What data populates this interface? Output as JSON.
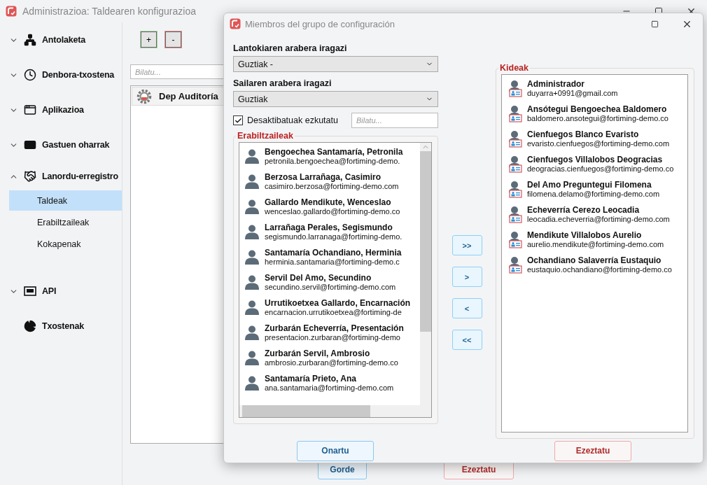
{
  "main_window": {
    "title": "Administrazioa: Taldearen konfigurazioa",
    "sidebar": [
      {
        "label": "Antolaketa",
        "kind": "section",
        "expanded": false
      },
      {
        "label": "Denbora-txostena",
        "kind": "section",
        "expanded": false
      },
      {
        "label": "Aplikazioa",
        "kind": "section",
        "expanded": false
      },
      {
        "label": "Gastuen oharrak",
        "kind": "section",
        "expanded": false
      },
      {
        "label": "Lanordu-erregistro",
        "kind": "section",
        "expanded": true,
        "children": [
          {
            "label": "Taldeak",
            "selected": true
          },
          {
            "label": "Erabiltzaileak",
            "selected": false
          },
          {
            "label": "Kokapenak",
            "selected": false
          }
        ]
      },
      {
        "label": "API",
        "kind": "section",
        "expanded": false
      },
      {
        "label": "Txostenak",
        "kind": "link"
      }
    ],
    "toolbar": [
      {
        "label": "+",
        "kind": "add"
      },
      {
        "label": "-",
        "kind": "remove"
      }
    ],
    "search": {
      "placeholder": "Bilatu..."
    },
    "groups": [
      {
        "name": "Dep Auditoría"
      }
    ],
    "buttons": [
      {
        "label": "Gorde",
        "kind": "confirm"
      },
      {
        "label": "Ezeztatu",
        "kind": "cancel"
      }
    ]
  },
  "dialog": {
    "title": "Miembros del grupo de configuración",
    "filters": [
      {
        "label": "Lantokiaren arabera iragazi",
        "value": "Guztiak -"
      },
      {
        "label": "Sailaren arabera iragazi",
        "value": "Guztiak"
      }
    ],
    "hide_inactive": {
      "label": "Desaktibatuak ezkutatu",
      "checked": true
    },
    "search": {
      "placeholder": "Bilatu..."
    },
    "users": {
      "title": "Erabiltzaileak",
      "items": [
        {
          "name": "Bengoechea Santamaría, Petronila",
          "email": "petronila.bengoechea@fortiming-demo."
        },
        {
          "name": "Berzosa Larrañaga, Casimiro",
          "email": "casimiro.berzosa@fortiming-demo.com"
        },
        {
          "name": "Gallardo Mendikute, Wenceslao",
          "email": "wenceslao.gallardo@fortiming-demo.co"
        },
        {
          "name": "Larrañaga Perales, Segismundo",
          "email": "segismundo.larranaga@fortiming-demo."
        },
        {
          "name": "Santamaría Ochandiano, Herminia",
          "email": "herminia.santamaria@fortiming-demo.c"
        },
        {
          "name": "Servil Del Amo, Secundino",
          "email": "secundino.servil@fortiming-demo.com"
        },
        {
          "name": "Urrutikoetxea Gallardo, Encarnación",
          "email": "encarnacion.urrutikoetxea@fortiming-de"
        },
        {
          "name": "Zurbarán Echeverría, Presentación",
          "email": "presentacion.zurbaran@fortiming-demo"
        },
        {
          "name": "Zurbarán Servil, Ambrosio",
          "email": "ambrosio.zurbaran@fortiming-demo.co"
        },
        {
          "name": "Santamaría Prieto, Ana",
          "email": "ana.santamaria@fortiming-demo.com"
        }
      ]
    },
    "transfer_buttons": [
      ">>",
      ">",
      "<",
      "<<"
    ],
    "members": {
      "title": "Kideak",
      "items": [
        {
          "name": "Administrador",
          "email": "duyarra+0991@gmail.com"
        },
        {
          "name": "Ansótegui Bengoechea Baldomero",
          "email": "baldomero.ansotegui@fortiming-demo.co"
        },
        {
          "name": "Cienfuegos Blanco Evaristo",
          "email": "evaristo.cienfuegos@fortiming-demo.com"
        },
        {
          "name": "Cienfuegos Villalobos Deogracias",
          "email": "deogracias.cienfuegos@fortiming-demo.co"
        },
        {
          "name": "Del Amo Preguntegui Filomena",
          "email": "filomena.delamo@fortiming-demo.com"
        },
        {
          "name": "Echeverría Cerezo Leocadia",
          "email": "leocadia.echeverria@fortiming-demo.com"
        },
        {
          "name": "Mendikute Villalobos Aurelio",
          "email": "aurelio.mendikute@fortiming-demo.com"
        },
        {
          "name": "Ochandiano Salaverría Eustaquio",
          "email": "eustaquio.ochandiano@fortiming-demo.co"
        }
      ]
    },
    "buttons": [
      {
        "label": "Onartu",
        "kind": "confirm"
      },
      {
        "label": "Ezeztatu",
        "kind": "cancel"
      }
    ]
  }
}
